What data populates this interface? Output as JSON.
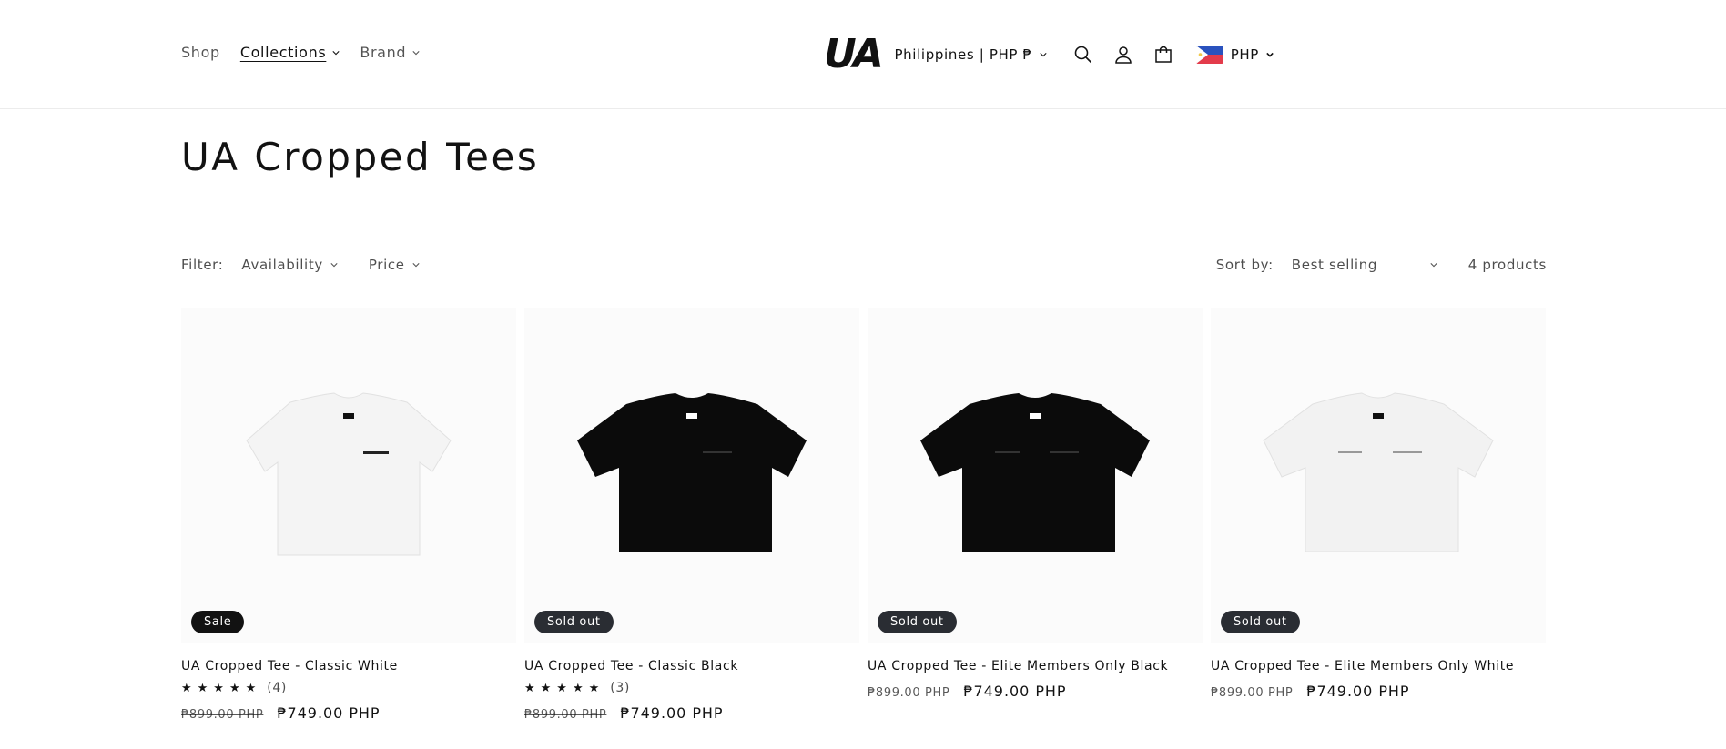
{
  "header": {
    "nav": [
      {
        "label": "Shop"
      },
      {
        "label": "Collections"
      },
      {
        "label": "Brand"
      }
    ],
    "logo_text": "UA",
    "country_selector": "Philippines | PHP ₱",
    "currency": "PHP"
  },
  "page_title": "UA Cropped Tees",
  "filters": {
    "label": "Filter:",
    "availability": "Availability",
    "price": "Price"
  },
  "sort": {
    "label": "Sort by:",
    "value": "Best selling",
    "count": "4 products"
  },
  "products": [
    {
      "title": "UA Cropped Tee - Classic White",
      "badge": "Sale",
      "stars": "★★★★★",
      "reviews": "(4)",
      "compare_price": "₱899.00 PHP",
      "price": "₱749.00 PHP",
      "shirt_color": "#f4f4f4"
    },
    {
      "title": "UA Cropped Tee - Classic Black",
      "badge": "Sold out",
      "stars": "★★★★★",
      "reviews": "(3)",
      "compare_price": "₱899.00 PHP",
      "price": "₱749.00 PHP",
      "shirt_color": "#0b0b0b"
    },
    {
      "title": "UA Cropped Tee - Elite Members Only Black",
      "badge": "Sold out",
      "compare_price": "₱899.00 PHP",
      "price": "₱749.00 PHP",
      "shirt_color": "#0b0b0b"
    },
    {
      "title": "UA Cropped Tee - Elite Members Only White",
      "badge": "Sold out",
      "compare_price": "₱899.00 PHP",
      "price": "₱749.00 PHP",
      "shirt_color": "#f2f2f2"
    }
  ],
  "colors": {
    "text": "#121212",
    "badge_sale": "#121212",
    "badge_soldout": "#2a2d33"
  }
}
